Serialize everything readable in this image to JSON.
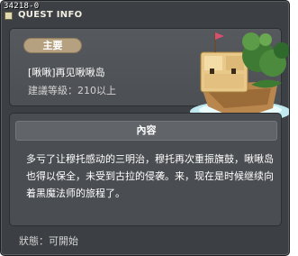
{
  "window": {
    "quest_id": "34218-0",
    "title": "QUEST INFO"
  },
  "summary": {
    "type_label": "主要",
    "quest_title": "[啾啾]再见啾啾岛",
    "level_requirement": "建議等級：210以上"
  },
  "content": {
    "header": "內容",
    "description": "多亏了让穆托感动的三明治，穆托再次重振旗鼓，啾啾岛也得以保全，未受到古拉的侵袭。来，现在是时候继续向着黑魔法师的旅程了。"
  },
  "status": {
    "text": "狀態：可開始"
  },
  "colors": {
    "window_bg": "#3c3f43",
    "panel_bg": "#4a4d51",
    "badge": "#b5a07f",
    "header_bar": "#61656a"
  },
  "icons": {
    "island": "floating-island-icon",
    "info": "info-square-icon"
  }
}
